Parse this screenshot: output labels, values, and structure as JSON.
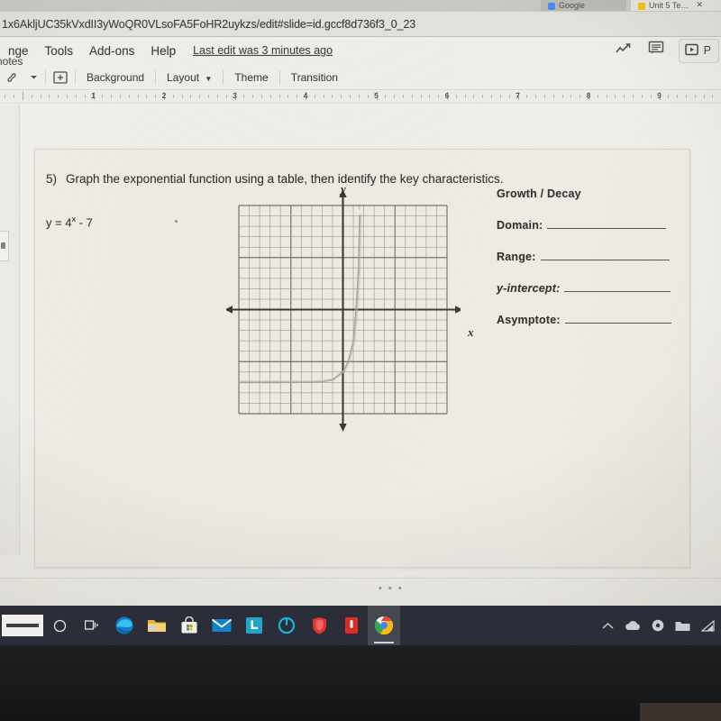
{
  "browser": {
    "tabs": [
      {
        "label": "Google",
        "favicon_color": "#4285f4",
        "active": false
      },
      {
        "label": "Unit 5 Te…",
        "favicon_color": "#f2c200",
        "active": true
      }
    ],
    "url": "1x6AkljUC35kVxdII3yWoQR0VLsoFA5FoHR2uykzs/edit#slide=id.gccf8d736f3_0_23"
  },
  "app": {
    "menus": [
      "nge",
      "Tools",
      "Add-ons",
      "Help"
    ],
    "last_edit": "Last edit was 3 minutes ago",
    "present_label": "P",
    "icons": {
      "explore": "trending-up-icon",
      "comment": "comment-icon",
      "present": "present-icon",
      "paint_format": "paint-format-icon",
      "dropdown": "chevron-down-icon",
      "new_slide": "new-slide-icon"
    },
    "toolbar": [
      "Background",
      "Layout",
      "Theme",
      "Transition"
    ],
    "ruler_numbers": [
      "1",
      "2",
      "3",
      "4",
      "5",
      "6",
      "7",
      "8",
      "9"
    ],
    "notes_placeholder": "ker notes",
    "notes_dots": "• • •"
  },
  "slide": {
    "question_number": "5)",
    "question_text": "Graph the exponential function using a table, then identify the key characteristics.",
    "function_base": "y = 4",
    "function_exponent": "x",
    "function_tail": " - 7",
    "answers": [
      {
        "label": "Growth  /  Decay",
        "line": false,
        "italic": false,
        "line_width": 0
      },
      {
        "label": "Domain:",
        "line": true,
        "italic": false,
        "line_width": 132
      },
      {
        "label": "Range:",
        "line": true,
        "italic": false,
        "line_width": 143
      },
      {
        "label": "y-intercept:",
        "line": true,
        "italic": true,
        "line_width": 118
      },
      {
        "label": "Asymptote:",
        "line": true,
        "italic": false,
        "line_width": 118
      }
    ]
  },
  "chart_data": {
    "type": "line",
    "title": "",
    "xlabel": "x",
    "ylabel": "y",
    "xlim": [
      -10,
      10
    ],
    "ylim": [
      -10,
      10
    ],
    "grid": true,
    "minor_step": 1,
    "major_step": 5,
    "cells_x": 20,
    "cells_y": 20,
    "legend": "none",
    "series": [
      {
        "name": "y = 4^x - 7",
        "hand_drawn": true,
        "x": [
          -10,
          -8,
          -6,
          -4,
          -3,
          -2,
          -1,
          0,
          0.5,
          1,
          1.3,
          1.5,
          1.6
        ],
        "y": [
          -7,
          -7,
          -7,
          -6.99,
          -6.98,
          -6.94,
          -6.75,
          -6,
          -5,
          -3,
          0.5,
          4,
          9
        ]
      }
    ],
    "asymptote": -7
  },
  "taskbar": {
    "items": [
      {
        "name": "search-box",
        "label": ""
      },
      {
        "name": "cortana-icon",
        "label": ""
      },
      {
        "name": "task-view-icon",
        "label": ""
      },
      {
        "name": "edge-icon",
        "label": ""
      },
      {
        "name": "file-explorer-icon",
        "label": ""
      },
      {
        "name": "microsoft-store-icon",
        "label": ""
      },
      {
        "name": "mail-icon",
        "label": ""
      },
      {
        "name": "lastpass-icon",
        "label": "L"
      },
      {
        "name": "ring-app-icon",
        "label": ""
      },
      {
        "name": "shield-app-icon",
        "label": ""
      },
      {
        "name": "pdf-app-icon",
        "label": ""
      },
      {
        "name": "chrome-icon",
        "label": ""
      }
    ],
    "tray": [
      "chevron-up-icon",
      "onedrive-icon",
      "disc-icon",
      "folder-icon",
      "wifi-icon"
    ]
  }
}
